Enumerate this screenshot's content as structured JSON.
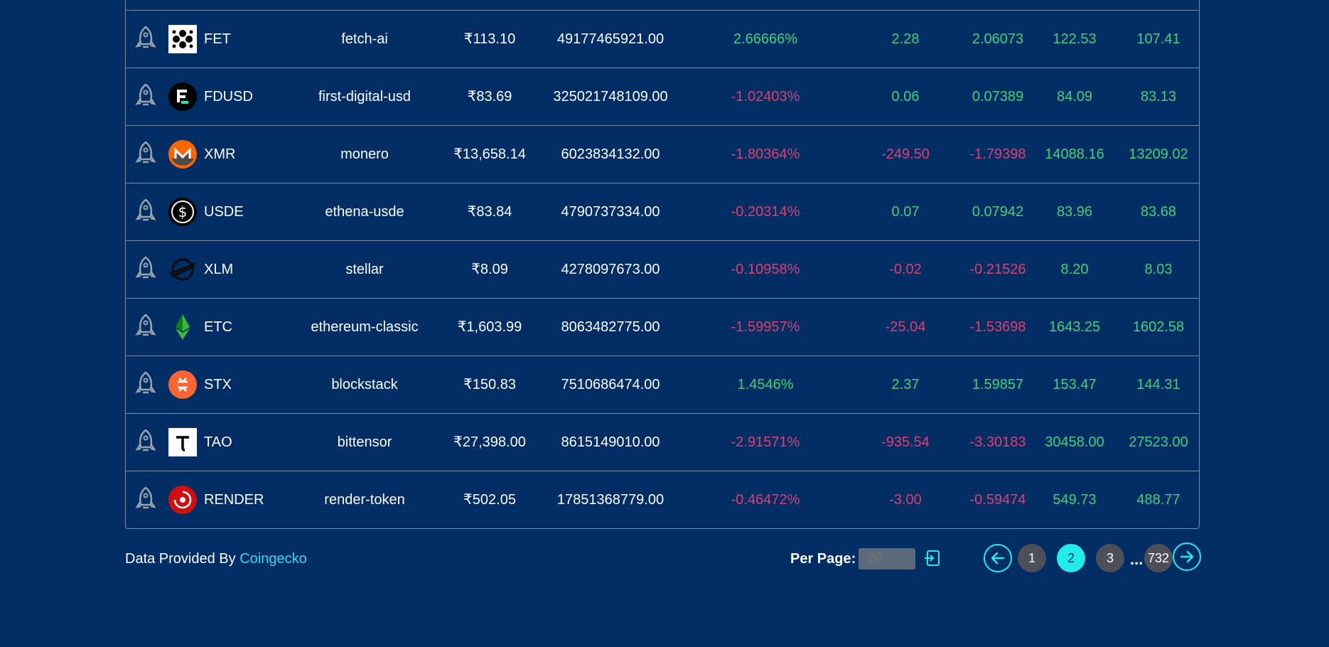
{
  "colors": {
    "background": "#002d64",
    "positive": "#3fd17a",
    "negative": "#e0406e",
    "accent": "#22ecea"
  },
  "rows": [
    {
      "symbol": "FET",
      "id": "fetch-ai",
      "price": "₹113.10",
      "market_cap": "49177465921.00",
      "change_pct": "2.66666%",
      "change_pct_dir": "pos",
      "change_abs": "2.28",
      "change_abs_dir": "pos",
      "change_ratio": "2.06073",
      "change_ratio_dir": "pos",
      "high": "122.53",
      "low": "107.41",
      "logo_icon": "fetch-ai-logo-icon"
    },
    {
      "symbol": "FDUSD",
      "id": "first-digital-usd",
      "price": "₹83.69",
      "market_cap": "325021748109.00",
      "change_pct": "-1.02403%",
      "change_pct_dir": "neg",
      "change_abs": "0.06",
      "change_abs_dir": "pos",
      "change_ratio": "0.07389",
      "change_ratio_dir": "pos",
      "high": "84.09",
      "low": "83.13",
      "logo_icon": "fdusd-logo-icon"
    },
    {
      "symbol": "XMR",
      "id": "monero",
      "price": "₹13,658.14",
      "market_cap": "6023834132.00",
      "change_pct": "-1.80364%",
      "change_pct_dir": "neg",
      "change_abs": "-249.50",
      "change_abs_dir": "neg",
      "change_ratio": "-1.79398",
      "change_ratio_dir": "neg",
      "high": "14088.16",
      "low": "13209.02",
      "logo_icon": "monero-logo-icon"
    },
    {
      "symbol": "USDE",
      "id": "ethena-usde",
      "price": "₹83.84",
      "market_cap": "4790737334.00",
      "change_pct": "-0.20314%",
      "change_pct_dir": "neg",
      "change_abs": "0.07",
      "change_abs_dir": "pos",
      "change_ratio": "0.07942",
      "change_ratio_dir": "pos",
      "high": "83.96",
      "low": "83.68",
      "logo_icon": "ethena-usde-logo-icon"
    },
    {
      "symbol": "XLM",
      "id": "stellar",
      "price": "₹8.09",
      "market_cap": "4278097673.00",
      "change_pct": "-0.10958%",
      "change_pct_dir": "neg",
      "change_abs": "-0.02",
      "change_abs_dir": "neg",
      "change_ratio": "-0.21526",
      "change_ratio_dir": "neg",
      "high": "8.20",
      "low": "8.03",
      "logo_icon": "stellar-logo-icon"
    },
    {
      "symbol": "ETC",
      "id": "ethereum-classic",
      "price": "₹1,603.99",
      "market_cap": "8063482775.00",
      "change_pct": "-1.59957%",
      "change_pct_dir": "neg",
      "change_abs": "-25.04",
      "change_abs_dir": "neg",
      "change_ratio": "-1.53698",
      "change_ratio_dir": "neg",
      "high": "1643.25",
      "low": "1602.58",
      "logo_icon": "ethereum-classic-logo-icon"
    },
    {
      "symbol": "STX",
      "id": "blockstack",
      "price": "₹150.83",
      "market_cap": "7510686474.00",
      "change_pct": "1.4546%",
      "change_pct_dir": "pos",
      "change_abs": "2.37",
      "change_abs_dir": "pos",
      "change_ratio": "1.59857",
      "change_ratio_dir": "pos",
      "high": "153.47",
      "low": "144.31",
      "logo_icon": "stacks-logo-icon"
    },
    {
      "symbol": "TAO",
      "id": "bittensor",
      "price": "₹27,398.00",
      "market_cap": "8615149010.00",
      "change_pct": "-2.91571%",
      "change_pct_dir": "neg",
      "change_abs": "-935.54",
      "change_abs_dir": "neg",
      "change_ratio": "-3.30183",
      "change_ratio_dir": "neg",
      "high": "30458.00",
      "low": "27523.00",
      "logo_icon": "bittensor-logo-icon"
    },
    {
      "symbol": "RENDER",
      "id": "render-token",
      "price": "₹502.05",
      "market_cap": "17851368779.00",
      "change_pct": "-0.46472%",
      "change_pct_dir": "neg",
      "change_abs": "-3.00",
      "change_abs_dir": "neg",
      "change_ratio": "-0.59474",
      "change_ratio_dir": "neg",
      "high": "549.73",
      "low": "488.77",
      "logo_icon": "render-logo-icon"
    }
  ],
  "footer": {
    "provided_by": "Data Provided By",
    "provider_link": "Coingecko",
    "per_page_label": "Per Page:",
    "per_page_placeholder": "20"
  },
  "pagination": {
    "pages": [
      "1",
      "2",
      "3"
    ],
    "active_page": "2",
    "ellipsis": "...",
    "last_page": "732"
  }
}
